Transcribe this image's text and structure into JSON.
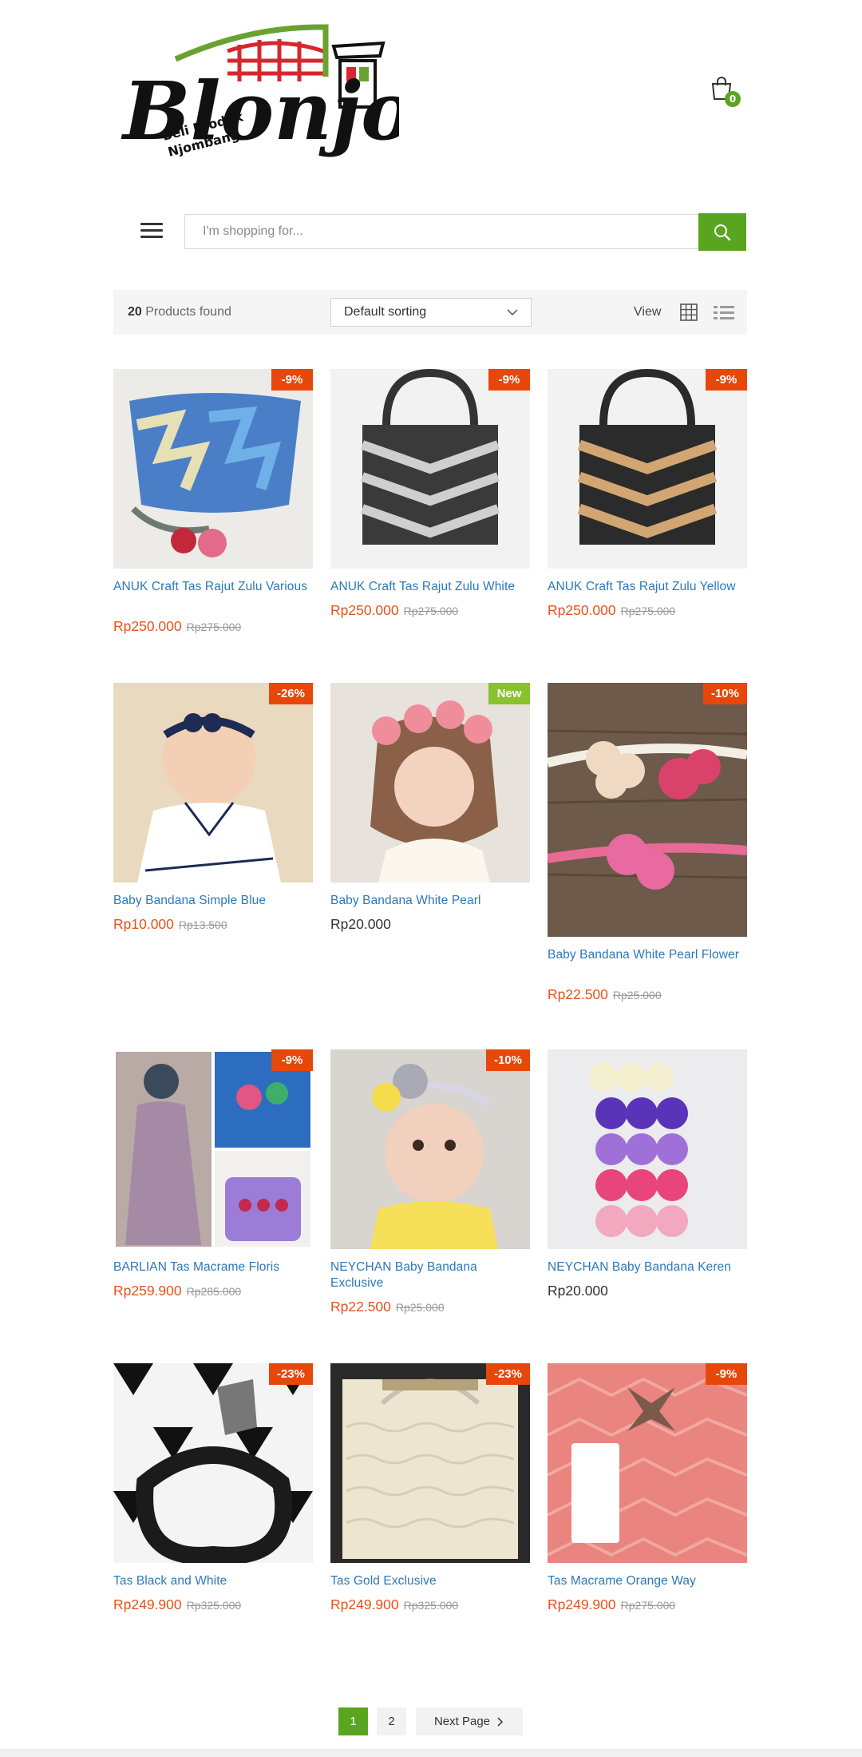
{
  "header": {
    "logo_text": "Blonjo online",
    "logo_tagline_1": "Beli Produk",
    "logo_tagline_2": "Njombang",
    "cart_count": "0"
  },
  "search": {
    "placeholder": "I'm shopping for..."
  },
  "toolbar": {
    "count": "20",
    "found_label": "Products found",
    "sort_value": "Default sorting",
    "view_label": "View"
  },
  "colors": {
    "accent": "#5aa51f",
    "sale": "#e8470c",
    "new": "#88c22f",
    "link": "#2b78b8",
    "price": "#e4521a"
  },
  "products": [
    {
      "name": "ANUK Craft Tas Rajut Zulu Various",
      "badge": "-9%",
      "price": "Rp250.000",
      "old_price": "Rp275.000"
    },
    {
      "name": "ANUK Craft Tas Rajut Zulu White",
      "badge": "-9%",
      "price": "Rp250.000",
      "old_price": "Rp275.000"
    },
    {
      "name": "ANUK Craft Tas Rajut Zulu Yellow",
      "badge": "-9%",
      "price": "Rp250.000",
      "old_price": "Rp275.000"
    },
    {
      "name": "Baby Bandana Simple Blue",
      "badge": "-26%",
      "price": "Rp10.000",
      "old_price": "Rp13.500"
    },
    {
      "name": "Baby Bandana White Pearl",
      "badge": "New",
      "price": "Rp20.000",
      "old_price": ""
    },
    {
      "name": "Baby Bandana White Pearl Flower",
      "badge": "-10%",
      "price": "Rp22.500",
      "old_price": "Rp25.000"
    },
    {
      "name": "BARLIAN Tas Macrame Floris",
      "badge": "-9%",
      "price": "Rp259.900",
      "old_price": "Rp285.000"
    },
    {
      "name": "NEYCHAN Baby Bandana Exclusive",
      "badge": "-10%",
      "price": "Rp22.500",
      "old_price": "Rp25.000"
    },
    {
      "name": "NEYCHAN Baby Bandana Keren",
      "badge": "",
      "price": "Rp20.000",
      "old_price": ""
    },
    {
      "name": "Tas Black and White",
      "badge": "-23%",
      "price": "Rp249.900",
      "old_price": "Rp325.000"
    },
    {
      "name": "Tas Gold Exclusive",
      "badge": "-23%",
      "price": "Rp249.900",
      "old_price": "Rp325.000"
    },
    {
      "name": "Tas Macrame Orange Way",
      "badge": "-9%",
      "price": "Rp249.900",
      "old_price": "Rp275.000"
    }
  ],
  "pagination": {
    "page1": "1",
    "page2": "2",
    "next": "Next Page"
  }
}
